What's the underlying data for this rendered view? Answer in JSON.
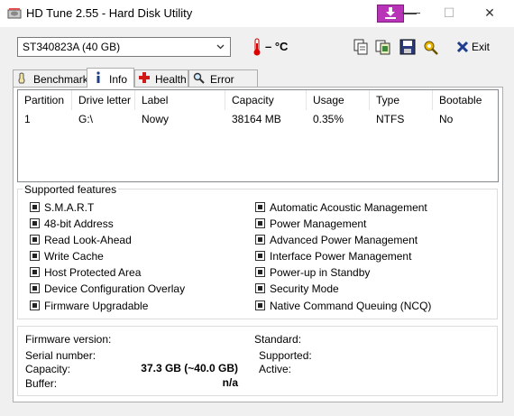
{
  "window": {
    "title": "HD Tune 2.55 - Hard Disk Utility",
    "minimize": "—",
    "maximize": "☐",
    "close": "✕"
  },
  "toolbar": {
    "drive": "ST340823A (40 GB)",
    "temperature": "– °C",
    "exit_label": "Exit"
  },
  "tabs": [
    {
      "label": "Benchmark"
    },
    {
      "label": "Info"
    },
    {
      "label": "Health"
    },
    {
      "label": "Error Scan"
    }
  ],
  "partitions": {
    "columns": [
      "Partition",
      "Drive letter",
      "Label",
      "Capacity",
      "Usage",
      "Type",
      "Bootable"
    ],
    "rows": [
      [
        "1",
        "G:\\",
        "Nowy",
        "38164 MB",
        "0.35%",
        "NTFS",
        "No"
      ]
    ]
  },
  "features": {
    "title": "Supported features",
    "left": [
      "S.M.A.R.T",
      "48-bit Address",
      "Read Look-Ahead",
      "Write Cache",
      "Host Protected Area",
      "Device Configuration Overlay",
      "Firmware Upgradable"
    ],
    "right": [
      "Automatic Acoustic Management",
      "Power Management",
      "Advanced Power Management",
      "Interface Power Management",
      "Power-up in Standby",
      "Security Mode",
      "Native Command Queuing (NCQ)"
    ]
  },
  "info": {
    "firmware_label": "Firmware version:",
    "firmware_value": "",
    "serial_label": "Serial number:",
    "serial_value": "",
    "capacity_label": "Capacity:",
    "capacity_value": "37.3 GB (~40.0 GB)",
    "buffer_label": "Buffer:",
    "buffer_value": "n/a",
    "standard_label": "Standard:",
    "supported_label": "Supported:",
    "active_label": "Active:"
  }
}
